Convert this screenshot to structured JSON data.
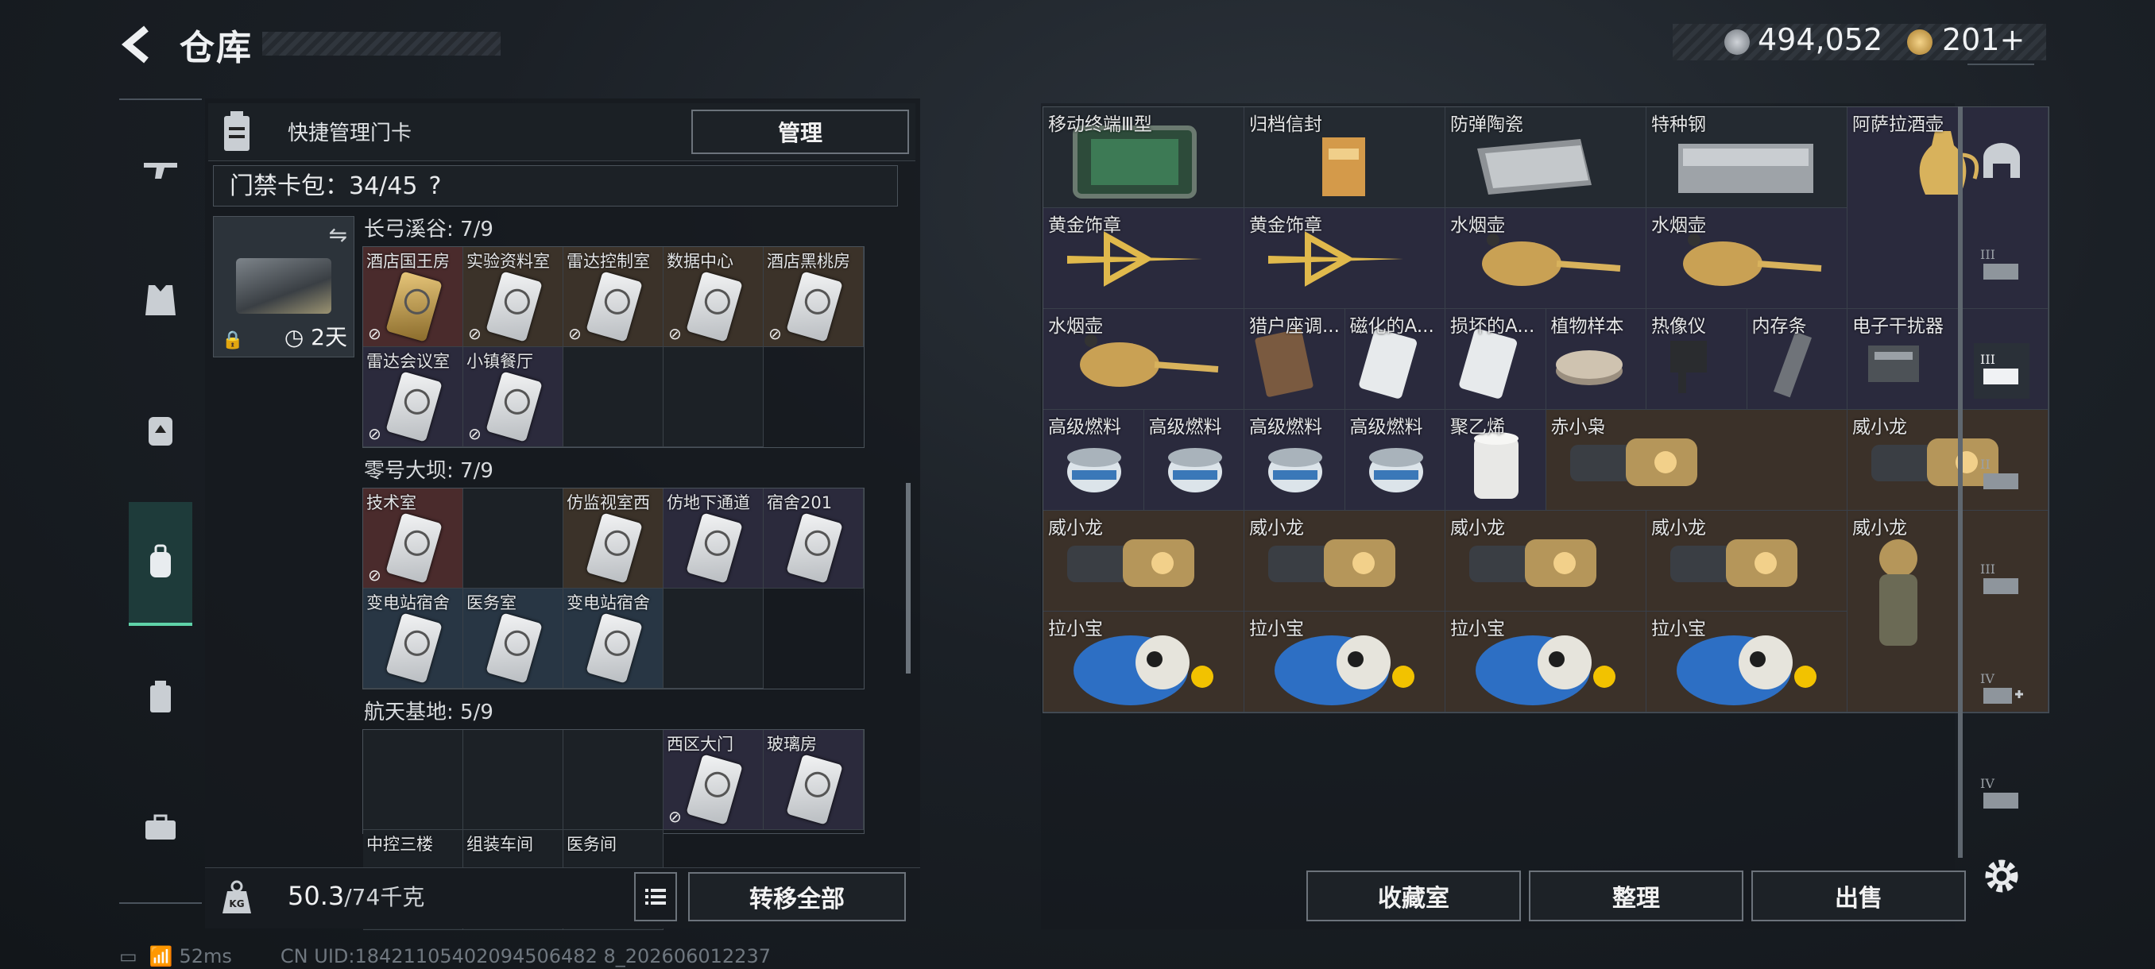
{
  "header": {
    "title": "仓库"
  },
  "currency": {
    "coins": "494,052",
    "tickets": "201+"
  },
  "card_panel": {
    "head_label": "快捷管理门卡",
    "manage_label": "管理",
    "bag_count": "门禁卡包：34/45",
    "help": "?",
    "keycase_time": "2天"
  },
  "groups": [
    {
      "title": "长弓溪谷: 7/9",
      "cells": [
        {
          "name": "酒店国王房",
          "style": "red",
          "card": "gold",
          "lock": true
        },
        {
          "name": "实验资料室",
          "style": "brown",
          "card": "white",
          "lock": true
        },
        {
          "name": "雷达控制室",
          "style": "brown",
          "card": "white",
          "lock": true
        },
        {
          "name": "数据中心",
          "style": "brown",
          "card": "white",
          "lock": true
        },
        {
          "name": "酒店黑桃房",
          "style": "brown",
          "card": "white",
          "lock": true
        },
        {
          "name": "雷达会议室",
          "style": "purple",
          "card": "white",
          "lock": true
        },
        {
          "name": "小镇餐厅",
          "style": "purple",
          "card": "white",
          "lock": true
        },
        {
          "name": "",
          "style": "empty"
        },
        {
          "name": "",
          "style": "empty"
        }
      ]
    },
    {
      "title": "零号大坝: 7/9",
      "cells": [
        {
          "name": "技术室",
          "style": "red",
          "card": "white",
          "lock": true
        },
        {
          "name": "",
          "style": "empty"
        },
        {
          "name": "仿监视室西",
          "style": "brown",
          "card": "white",
          "lock": false
        },
        {
          "name": "仿地下通道",
          "style": "purple",
          "card": "white",
          "lock": false
        },
        {
          "name": "宿舍201",
          "style": "purple",
          "card": "white",
          "lock": false
        },
        {
          "name": "变电站宿舍",
          "style": "blue",
          "card": "white",
          "lock": false
        },
        {
          "name": "医务室",
          "style": "blue",
          "card": "white",
          "lock": false
        },
        {
          "name": "变电站宿舍",
          "style": "blue",
          "card": "white",
          "lock": false
        },
        {
          "name": "",
          "style": "empty"
        }
      ]
    },
    {
      "title": "航天基地: 5/9",
      "cells": [
        {
          "name": "",
          "style": "empty"
        },
        {
          "name": "",
          "style": "empty"
        },
        {
          "name": "",
          "style": "empty"
        },
        {
          "name": "西区大门",
          "style": "purple",
          "card": "white",
          "lock": true
        },
        {
          "name": "玻璃房",
          "style": "purple",
          "card": "white",
          "lock": false
        },
        {
          "name": "中控三楼",
          "style": "empty"
        },
        {
          "name": "组装车间",
          "style": "empty"
        },
        {
          "name": "医务间",
          "style": "empty"
        }
      ]
    }
  ],
  "weight": {
    "value": "50.3",
    "unit": "/74千克"
  },
  "transfer_label": "转移全部",
  "stash": {
    "rows": [
      [
        {
          "name": "移动终端Ⅲ型",
          "c": "g",
          "art": "tablet"
        },
        {
          "name": "归档信封",
          "c": "g",
          "art": "envelope"
        },
        {
          "name": "防弹陶瓷",
          "c": "g",
          "art": "plate"
        },
        {
          "name": "特种钢",
          "c": "g",
          "art": "steel"
        },
        {
          "name": "阿萨拉酒壶",
          "c": "p",
          "art": "jug"
        }
      ],
      [
        {
          "name": "黄金饰章",
          "c": "p",
          "art": "badge"
        },
        {
          "name": "黄金饰章",
          "c": "p",
          "art": "badge"
        },
        {
          "name": "水烟壶",
          "c": "p",
          "art": "pipe"
        },
        {
          "name": "水烟壶",
          "c": "p",
          "art": "pipe"
        },
        {
          "name": "",
          "c": "p",
          "art": "jug2"
        }
      ],
      [
        {
          "name": "水烟壶",
          "c": "p",
          "art": "pipe"
        },
        {
          "name": "猎户座调...",
          "c": "p",
          "art": "phone"
        },
        {
          "name": "磁化的A...",
          "c": "p",
          "art": "card"
        },
        {
          "name": "损坏的A...",
          "c": "p",
          "art": "card"
        },
        {
          "name": "植物样本",
          "c": "p",
          "art": "dish"
        },
        {
          "name": "热像仪",
          "c": "p",
          "art": "cam"
        },
        {
          "name": "内存条",
          "c": "p",
          "art": "ram"
        },
        {
          "name": "电子干扰器",
          "c": "p",
          "art": "jammer"
        }
      ],
      [
        {
          "name": "高级燃料",
          "c": "p",
          "art": "can"
        },
        {
          "name": "高级燃料",
          "c": "p",
          "art": "can"
        },
        {
          "name": "高级燃料",
          "c": "p",
          "art": "can"
        },
        {
          "name": "高级燃料",
          "c": "p",
          "art": "can"
        },
        {
          "name": "聚乙烯",
          "c": "p",
          "art": "roll"
        },
        {
          "name": "赤小枭",
          "c": "b",
          "art": "toy"
        },
        {
          "name": "威小龙",
          "c": "b",
          "art": "toy"
        }
      ],
      [
        {
          "name": "威小龙",
          "c": "b",
          "art": "toy"
        },
        {
          "name": "威小龙",
          "c": "b",
          "art": "toy"
        },
        {
          "name": "威小龙",
          "c": "b",
          "art": "toy"
        },
        {
          "name": "威小龙",
          "c": "b",
          "art": "toy"
        },
        {
          "name": "威小龙",
          "c": "b",
          "art": "fig"
        }
      ],
      [
        {
          "name": "拉小宝",
          "c": "b",
          "art": "plush"
        },
        {
          "name": "拉小宝",
          "c": "b",
          "art": "plush"
        },
        {
          "name": "拉小宝",
          "c": "b",
          "art": "plush"
        },
        {
          "name": "拉小宝",
          "c": "b",
          "art": "plush"
        }
      ]
    ]
  },
  "bottom_buttons": {
    "collect": "收藏室",
    "sort": "整理",
    "sell": "出售"
  },
  "status": {
    "ping": "52ms",
    "uid": "CN UID:18421105402094506482 8_202606012237"
  },
  "colors": {
    "accent": "#5fd3a9",
    "red_tile": "#4a2b2c",
    "gold_tile": "#3b3129",
    "purple_tile": "#2a2a3d"
  }
}
